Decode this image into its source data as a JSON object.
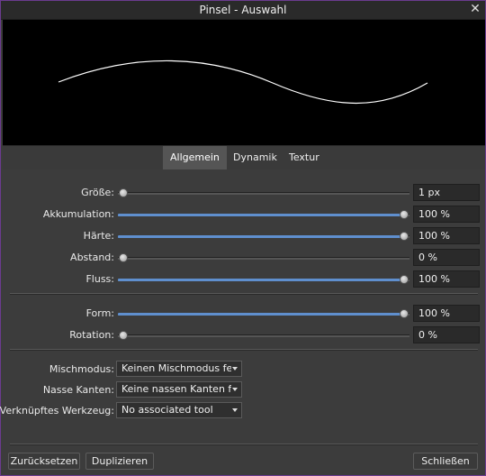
{
  "window": {
    "title": "Pinsel - Auswahl",
    "close_symbol": "✕"
  },
  "tabs": [
    {
      "label": "Allgemein",
      "active": true
    },
    {
      "label": "Dynamik",
      "active": false
    },
    {
      "label": "Textur",
      "active": false
    }
  ],
  "sliders": [
    {
      "label": "Größe:",
      "value": "1 px",
      "level": 0.0
    },
    {
      "label": "Akkumulation:",
      "value": "100 %",
      "level": 1.0
    },
    {
      "label": "Härte:",
      "value": "100 %",
      "level": 1.0
    },
    {
      "label": "Abstand:",
      "value": "0 %",
      "level": 0.0
    },
    {
      "label": "Fluss:",
      "value": "100 %",
      "level": 1.0
    },
    {
      "label": "Form:",
      "value": "100 %",
      "level": 1.0
    },
    {
      "label": "Rotation:",
      "value": "0 %",
      "level": 0.0
    }
  ],
  "dropdowns": [
    {
      "label": "Mischmodus:",
      "value": "Keinen Mischmodus festl"
    },
    {
      "label": "Nasse Kanten:",
      "value": "Keine nassen Kanten fest"
    },
    {
      "label": "Verknüpftes Werkzeug:",
      "value": "No associated tool"
    }
  ],
  "buttons": {
    "reset": "Zurücksetzen",
    "duplicate": "Duplizieren",
    "close": "Schließen"
  },
  "colors": {
    "accent": "#5f8fce",
    "preview_bg": "#000000",
    "stroke": "#ffffff"
  }
}
